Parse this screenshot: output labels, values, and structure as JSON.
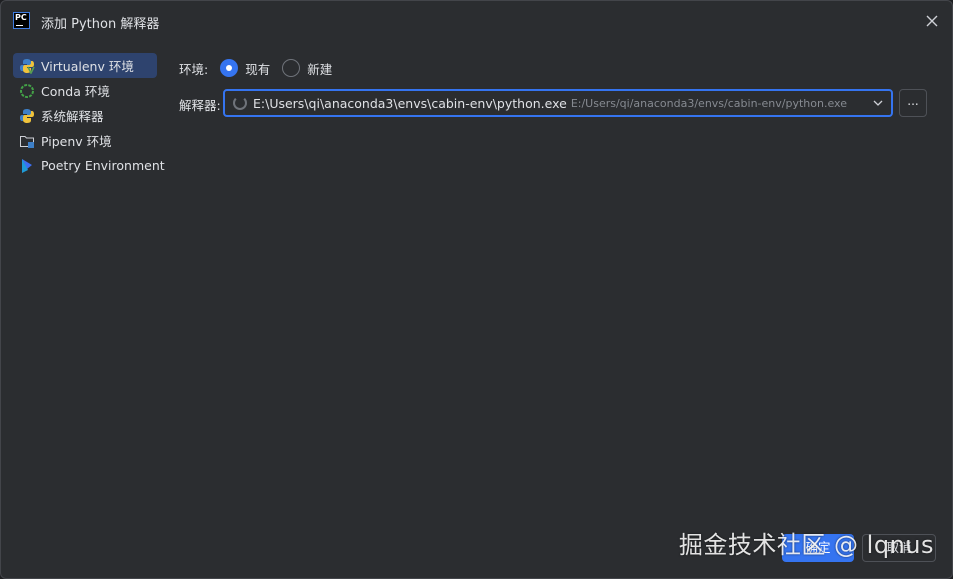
{
  "window": {
    "title": "添加 Python 解释器",
    "app_icon_text": "PC"
  },
  "sidebar": {
    "items": [
      {
        "label": "Virtualenv 环境",
        "icon": "virtualenv-icon",
        "selected": true
      },
      {
        "label": "Conda 环境",
        "icon": "conda-icon",
        "selected": false
      },
      {
        "label": "系统解释器",
        "icon": "python-icon",
        "selected": false
      },
      {
        "label": "Pipenv 环境",
        "icon": "pipenv-folder-icon",
        "selected": false
      },
      {
        "label": "Poetry Environment",
        "icon": "poetry-icon",
        "selected": false
      }
    ]
  },
  "environment": {
    "label": "环境:",
    "options": [
      {
        "label": "现有",
        "selected": true
      },
      {
        "label": "新建",
        "selected": false
      }
    ]
  },
  "interpreter": {
    "label": "解释器:",
    "path": "E:\\Users\\qi\\anaconda3\\envs\\cabin-env\\python.exe",
    "path_hint": "E:/Users/qi/anaconda3/envs/cabin-env/python.exe",
    "browse_label": "..."
  },
  "buttons": {
    "ok": "确定",
    "cancel": "取消"
  },
  "watermark": "掘金技术社区 @ lqnus",
  "colors": {
    "background": "#2b2d30",
    "accent": "#3574f0",
    "selection": "#2e436e",
    "text": "#dfe1e5"
  }
}
